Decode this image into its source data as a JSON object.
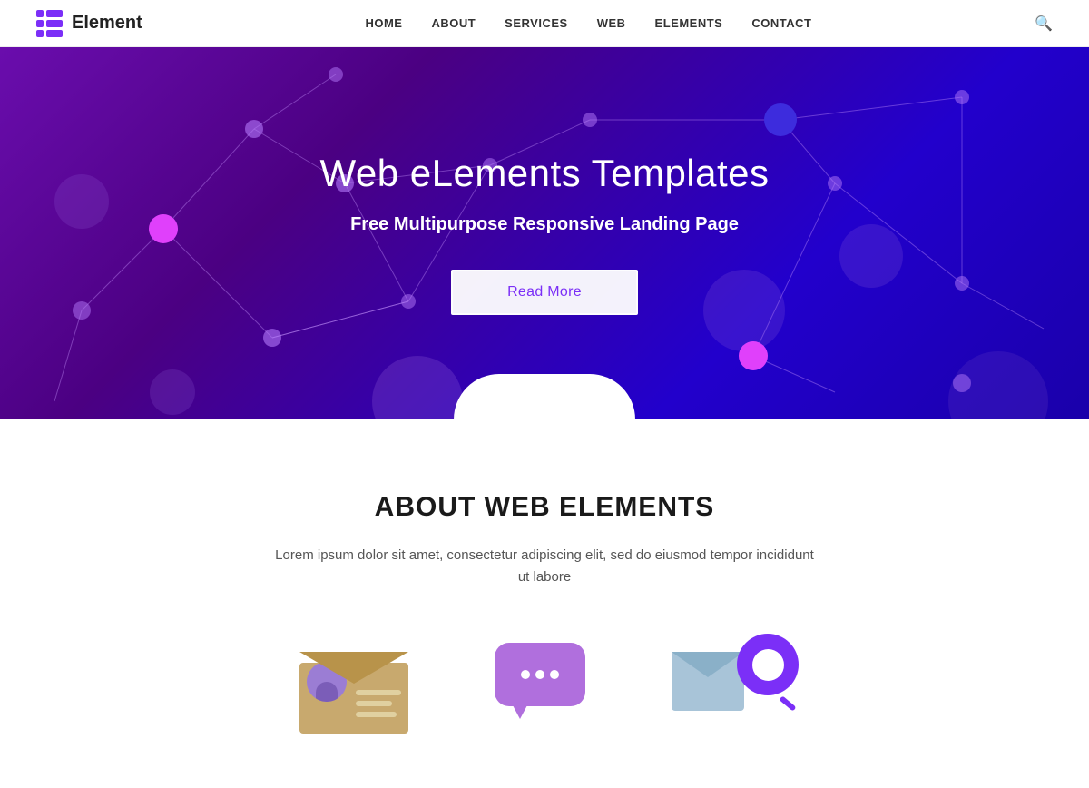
{
  "navbar": {
    "logo_text": "Element",
    "links": [
      {
        "label": "HOME",
        "id": "home"
      },
      {
        "label": "ABOUT",
        "id": "about"
      },
      {
        "label": "SERVICES",
        "id": "services"
      },
      {
        "label": "WEB",
        "id": "web"
      },
      {
        "label": "ELEMENTS",
        "id": "elements"
      },
      {
        "label": "CONTACT",
        "id": "contact"
      }
    ]
  },
  "hero": {
    "title": "Web eLements Templates",
    "subtitle": "Free Multipurpose Responsive Landing Page",
    "cta_label": "Read More"
  },
  "about": {
    "title": "ABOUT WEB ELEMENTS",
    "description": "Lorem ipsum dolor sit amet, consectetur adipiscing elit, sed do eiusmod tempor incididunt ut labore"
  },
  "colors": {
    "purple": "#7b2ff7",
    "dark_purple": "#4b0082"
  }
}
